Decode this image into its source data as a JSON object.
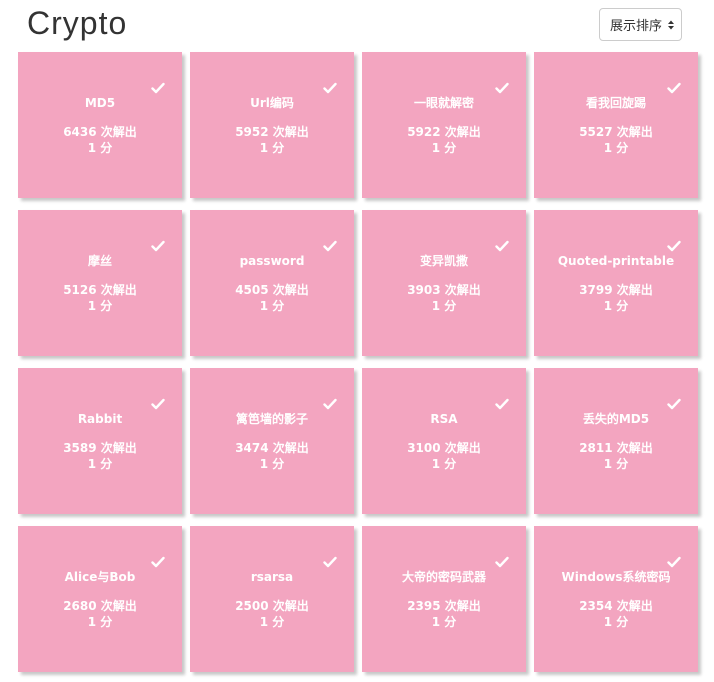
{
  "page": {
    "title": "Crypto",
    "sort_label": "展示排序",
    "accent_color": "#f3a5c0"
  },
  "challenges": [
    {
      "name": "MD5",
      "solves": "6436 次解出",
      "score": "1 分",
      "solved": true
    },
    {
      "name": "Url编码",
      "solves": "5952 次解出",
      "score": "1 分",
      "solved": true
    },
    {
      "name": "一眼就解密",
      "solves": "5922 次解出",
      "score": "1 分",
      "solved": true
    },
    {
      "name": "看我回旋踢",
      "solves": "5527 次解出",
      "score": "1 分",
      "solved": true
    },
    {
      "name": "摩丝",
      "solves": "5126 次解出",
      "score": "1 分",
      "solved": true
    },
    {
      "name": "password",
      "solves": "4505 次解出",
      "score": "1 分",
      "solved": true
    },
    {
      "name": "变异凯撒",
      "solves": "3903 次解出",
      "score": "1 分",
      "solved": true
    },
    {
      "name": "Quoted-printable",
      "solves": "3799 次解出",
      "score": "1 分",
      "solved": true
    },
    {
      "name": "Rabbit",
      "solves": "3589 次解出",
      "score": "1 分",
      "solved": true
    },
    {
      "name": "篱笆墙的影子",
      "solves": "3474 次解出",
      "score": "1 分",
      "solved": true
    },
    {
      "name": "RSA",
      "solves": "3100 次解出",
      "score": "1 分",
      "solved": true
    },
    {
      "name": "丢失的MD5",
      "solves": "2811 次解出",
      "score": "1 分",
      "solved": true
    },
    {
      "name": "Alice与Bob",
      "solves": "2680 次解出",
      "score": "1 分",
      "solved": true
    },
    {
      "name": "rsarsa",
      "solves": "2500 次解出",
      "score": "1 分",
      "solved": true
    },
    {
      "name": "大帝的密码武器",
      "solves": "2395 次解出",
      "score": "1 分",
      "solved": true
    },
    {
      "name": "Windows系统密码",
      "solves": "2354 次解出",
      "score": "1 分",
      "solved": true
    }
  ]
}
